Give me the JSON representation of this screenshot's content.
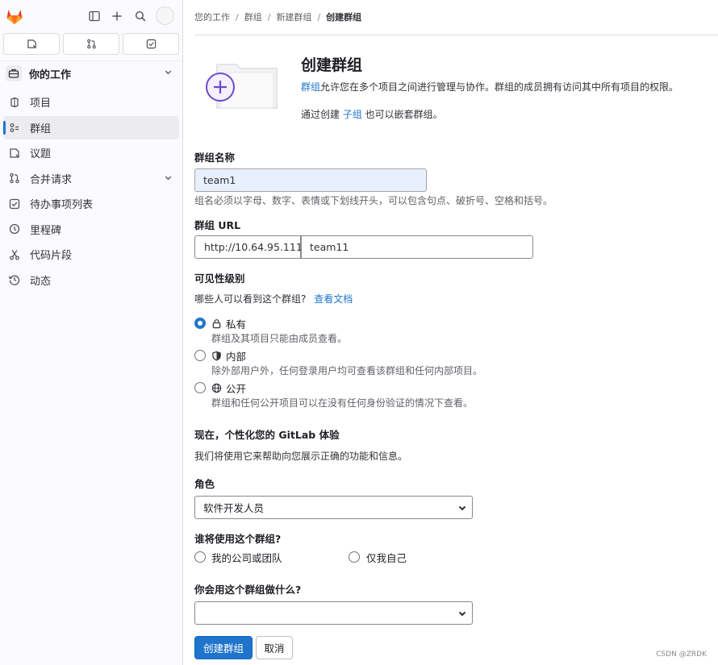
{
  "sidebar": {
    "context_label": "你的工作",
    "items": [
      {
        "label": "项目",
        "icon": "project-icon"
      },
      {
        "label": "群组",
        "icon": "group-icon",
        "active": true
      },
      {
        "label": "议题",
        "icon": "issues-icon"
      },
      {
        "label": "合并请求",
        "icon": "merge-request-icon",
        "expandable": true
      },
      {
        "label": "待办事项列表",
        "icon": "todo-icon"
      },
      {
        "label": "里程碑",
        "icon": "milestone-icon"
      },
      {
        "label": "代码片段",
        "icon": "snippet-icon"
      },
      {
        "label": "动态",
        "icon": "activity-icon"
      }
    ]
  },
  "breadcrumb": [
    "您的工作",
    "群组",
    "新建群组",
    "创建群组"
  ],
  "hero": {
    "title": "创建群组",
    "desc_link": "群组",
    "desc_rest": "允许您在多个项目之间进行管理与协作。群组的成员拥有访问其中所有项目的权限。",
    "desc2_pre": "通过创建 ",
    "desc2_link": "子组",
    "desc2_post": " 也可以嵌套群组。"
  },
  "form": {
    "name_label": "群组名称",
    "name_value": "team1",
    "name_help": "组名必须以字母、数字、表情或下划线开头，可以包含句点、破折号、空格和括号。",
    "url_label": "群组 URL",
    "url_prefix": "http://10.64.95.111/",
    "url_value": "team11",
    "visibility_label": "可见性级别",
    "visibility_question": "哪些人可以看到这个群组?",
    "visibility_doc_link": "查看文档",
    "visibility_options": [
      {
        "label": "私有",
        "help": "群组及其项目只能由成员查看。",
        "icon": "lock-icon",
        "checked": true
      },
      {
        "label": "内部",
        "help": "除外部用户外，任何登录用户均可查看该群组和任何内部项目。",
        "icon": "shield-icon",
        "checked": false
      },
      {
        "label": "公开",
        "help": "群组和任何公开项目可以在没有任何身份验证的情况下查看。",
        "icon": "globe-icon",
        "checked": false
      }
    ],
    "personalize_title": "现在，个性化您的 GitLab 体验",
    "personalize_desc": "我们将使用它来帮助向您展示正确的功能和信息。",
    "role_label": "角色",
    "role_value": "软件开发人员",
    "who_label": "谁将使用这个群组?",
    "who_options": [
      "我的公司或团队",
      "仅我自己"
    ],
    "purpose_label": "你会用这个群组做什么?",
    "purpose_value": "",
    "submit_label": "创建群组",
    "cancel_label": "取消"
  },
  "watermark": "CSDN @ZRDK",
  "colors": {
    "accent": "#1f75cb",
    "brand_orange": "#fc6d26",
    "purple": "#6e49cb"
  }
}
